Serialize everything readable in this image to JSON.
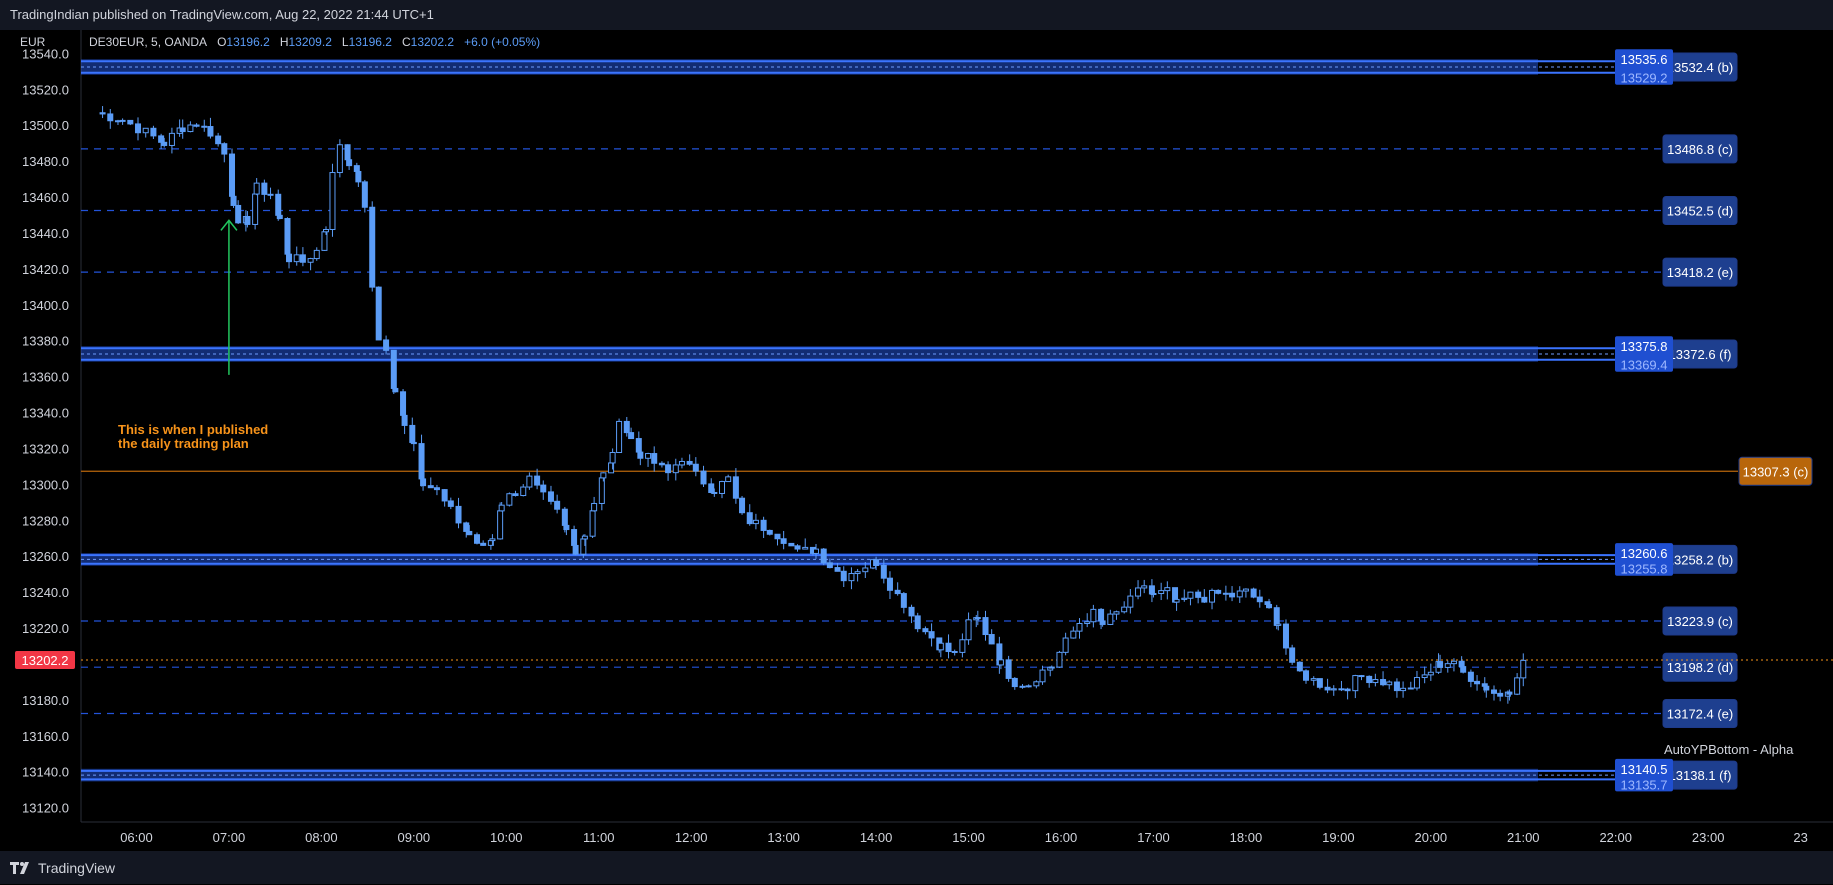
{
  "header": {
    "publish_text": "TradingIndian published on TradingView.com, Aug 22, 2022 21:44 UTC+1"
  },
  "footer": {
    "brand": "TradingView"
  },
  "legend": {
    "symbol": "DE30EUR, 5, OANDA",
    "open_label": "O",
    "open": "13196.2",
    "high_label": "H",
    "high": "13209.2",
    "low_label": "L",
    "low": "13196.2",
    "close_label": "C",
    "close": "13202.2",
    "change": "+6.0 (+0.05%)"
  },
  "currency": "EUR",
  "annotation": {
    "line1": "This is when I published",
    "line2": "the daily trading plan"
  },
  "indicator_name": "AutoYPBottom - Alpha",
  "colors": {
    "candle": "#5b9cf6",
    "zone": "#2962ff",
    "orange": "#b8660b",
    "arrow": "#22c55e",
    "current": "#f23645",
    "annotation": "#f7931a"
  },
  "chart_data": {
    "type": "candlestick",
    "ylim": [
      13112,
      13553
    ],
    "y_ticks": [
      13540.0,
      13520.0,
      13500.0,
      13480.0,
      13460.0,
      13440.0,
      13420.0,
      13400.0,
      13380.0,
      13360.0,
      13340.0,
      13320.0,
      13300.0,
      13280.0,
      13260.0,
      13240.0,
      13220.0,
      13200.0,
      13180.0,
      13160.0,
      13140.0,
      13120.0
    ],
    "x_ticks": [
      "06:00",
      "07:00",
      "08:00",
      "09:00",
      "10:00",
      "11:00",
      "12:00",
      "13:00",
      "14:00",
      "15:00",
      "16:00",
      "17:00",
      "18:00",
      "19:00",
      "20:00",
      "21:00",
      "22:00",
      "23:00",
      "23"
    ],
    "x_tick_hours": [
      6,
      7,
      8,
      9,
      10,
      11,
      12,
      13,
      14,
      15,
      16,
      17,
      18,
      19,
      20,
      21,
      22,
      23,
      24
    ],
    "x_range_hours": [
      5.4,
      24.35
    ],
    "current_price": {
      "label": "13202.2",
      "value": 13202.2
    },
    "zones": [
      {
        "upper": 13535.6,
        "lower": 13529.2,
        "upper_label": "13535.6",
        "lower_label": "13529.2",
        "label": "13532.4 (b)",
        "value": 13532.4
      },
      {
        "upper": 13375.8,
        "lower": 13369.4,
        "upper_label": "13375.8",
        "lower_label": "13369.4",
        "label": "13372.6 (f)",
        "value": 13372.6
      },
      {
        "upper": 13260.6,
        "lower": 13255.8,
        "upper_label": "13260.6",
        "lower_label": "13255.8",
        "label": "13258.2 (b)",
        "value": 13258.2
      },
      {
        "upper": 13140.5,
        "lower": 13135.7,
        "upper_label": "13140.5",
        "lower_label": "13135.7",
        "label": "13138.1 (f)",
        "value": 13138.1
      }
    ],
    "dashed_levels": [
      {
        "value": 13486.8,
        "label": "13486.8 (c)"
      },
      {
        "value": 13452.5,
        "label": "13452.5 (d)"
      },
      {
        "value": 13418.2,
        "label": "13418.2 (e)"
      },
      {
        "value": 13223.9,
        "label": "13223.9 (c)"
      },
      {
        "value": 13198.2,
        "label": "13198.2 (d)"
      },
      {
        "value": 13172.4,
        "label": "13172.4 (e)"
      }
    ],
    "solid_level": {
      "value": 13307.3,
      "label": "13307.3 (c)"
    },
    "arrow": {
      "hour": 7.0,
      "from": 13361,
      "to": 13447
    },
    "series_points": [
      [
        5.55,
        13507
      ],
      [
        5.85,
        13503
      ],
      [
        6.1,
        13496
      ],
      [
        6.3,
        13490
      ],
      [
        6.5,
        13499
      ],
      [
        6.65,
        13501
      ],
      [
        6.8,
        13496
      ],
      [
        6.95,
        13484
      ],
      [
        7.05,
        13458
      ],
      [
        7.1,
        13443
      ],
      [
        7.2,
        13447
      ],
      [
        7.3,
        13465
      ],
      [
        7.45,
        13462
      ],
      [
        7.55,
        13447
      ],
      [
        7.65,
        13426
      ],
      [
        7.8,
        13424
      ],
      [
        7.95,
        13430
      ],
      [
        8.05,
        13444
      ],
      [
        8.12,
        13472
      ],
      [
        8.2,
        13490
      ],
      [
        8.3,
        13480
      ],
      [
        8.4,
        13470
      ],
      [
        8.47,
        13452
      ],
      [
        8.55,
        13410
      ],
      [
        8.62,
        13382
      ],
      [
        8.7,
        13374
      ],
      [
        8.8,
        13350
      ],
      [
        8.9,
        13335
      ],
      [
        9.0,
        13323
      ],
      [
        9.1,
        13302
      ],
      [
        9.25,
        13296
      ],
      [
        9.4,
        13285
      ],
      [
        9.6,
        13272
      ],
      [
        9.75,
        13264
      ],
      [
        9.85,
        13270
      ],
      [
        9.95,
        13290
      ],
      [
        10.1,
        13296
      ],
      [
        10.25,
        13303
      ],
      [
        10.4,
        13293
      ],
      [
        10.55,
        13284
      ],
      [
        10.65,
        13274
      ],
      [
        10.75,
        13264
      ],
      [
        10.85,
        13272
      ],
      [
        10.95,
        13290
      ],
      [
        11.05,
        13305
      ],
      [
        11.15,
        13315
      ],
      [
        11.22,
        13338
      ],
      [
        11.35,
        13325
      ],
      [
        11.45,
        13317
      ],
      [
        11.6,
        13312
      ],
      [
        11.75,
        13306
      ],
      [
        11.9,
        13315
      ],
      [
        12.05,
        13305
      ],
      [
        12.25,
        13297
      ],
      [
        12.4,
        13303
      ],
      [
        12.55,
        13282
      ],
      [
        12.7,
        13278
      ],
      [
        12.85,
        13275
      ],
      [
        13.0,
        13270
      ],
      [
        13.15,
        13262
      ],
      [
        13.35,
        13264
      ],
      [
        13.5,
        13255
      ],
      [
        13.65,
        13249
      ],
      [
        13.8,
        13253
      ],
      [
        14.0,
        13257
      ],
      [
        14.15,
        13244
      ],
      [
        14.3,
        13234
      ],
      [
        14.45,
        13222
      ],
      [
        14.6,
        13215
      ],
      [
        14.7,
        13210
      ],
      [
        14.85,
        13205
      ],
      [
        15.0,
        13222
      ],
      [
        15.1,
        13225
      ],
      [
        15.25,
        13212
      ],
      [
        15.35,
        13200
      ],
      [
        15.5,
        13190
      ],
      [
        15.65,
        13189
      ],
      [
        15.8,
        13196
      ],
      [
        15.9,
        13199
      ],
      [
        16.05,
        13212
      ],
      [
        16.2,
        13223
      ],
      [
        16.35,
        13228
      ],
      [
        16.45,
        13222
      ],
      [
        16.6,
        13228
      ],
      [
        16.75,
        13235
      ],
      [
        16.9,
        13244
      ],
      [
        17.0,
        13238
      ],
      [
        17.15,
        13240
      ],
      [
        17.25,
        13233
      ],
      [
        17.4,
        13238
      ],
      [
        17.55,
        13237
      ],
      [
        17.7,
        13239
      ],
      [
        17.85,
        13238
      ],
      [
        18.0,
        13240
      ],
      [
        18.15,
        13235
      ],
      [
        18.25,
        13230
      ],
      [
        18.35,
        13223
      ],
      [
        18.5,
        13198
      ],
      [
        18.65,
        13193
      ],
      [
        18.8,
        13189
      ],
      [
        18.95,
        13186
      ],
      [
        19.1,
        13188
      ],
      [
        19.25,
        13193
      ],
      [
        19.4,
        13192
      ],
      [
        19.55,
        13189
      ],
      [
        19.7,
        13185
      ],
      [
        19.85,
        13190
      ],
      [
        20.0,
        13196
      ],
      [
        20.1,
        13200
      ],
      [
        20.25,
        13202
      ],
      [
        20.35,
        13195
      ],
      [
        20.5,
        13191
      ],
      [
        20.6,
        13187
      ],
      [
        20.75,
        13182
      ],
      [
        20.85,
        13186
      ],
      [
        21.0,
        13202
      ]
    ]
  }
}
